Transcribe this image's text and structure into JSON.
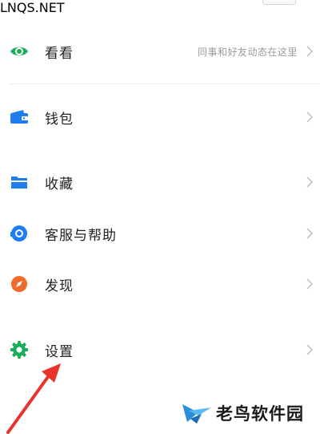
{
  "menu": {
    "items": [
      {
        "id": "kankan",
        "label": "看看",
        "hint": "同事和好友动态在这里",
        "icon": "eye-icon",
        "color": "#1aad5a"
      },
      {
        "id": "wallet",
        "label": "钱包",
        "hint": "",
        "icon": "wallet-icon",
        "color": "#1e7df0"
      },
      {
        "id": "favorites",
        "label": "收藏",
        "hint": "",
        "icon": "folder-icon",
        "color": "#1e7df0"
      },
      {
        "id": "support",
        "label": "客服与帮助",
        "hint": "",
        "icon": "headset-icon",
        "color": "#1e7df0"
      },
      {
        "id": "discover",
        "label": "发现",
        "hint": "",
        "icon": "compass-icon",
        "color": "#f06a2a"
      },
      {
        "id": "settings",
        "label": "设置",
        "hint": "",
        "icon": "gear-icon",
        "color": "#1aad5a"
      }
    ],
    "chevron": "chevron-right-icon"
  },
  "annotation": {
    "arrow_color": "#e8342c",
    "icon": "arrow-icon"
  },
  "watermark": {
    "text": "老鸟软件园",
    "sub": "LNQS.NET"
  }
}
